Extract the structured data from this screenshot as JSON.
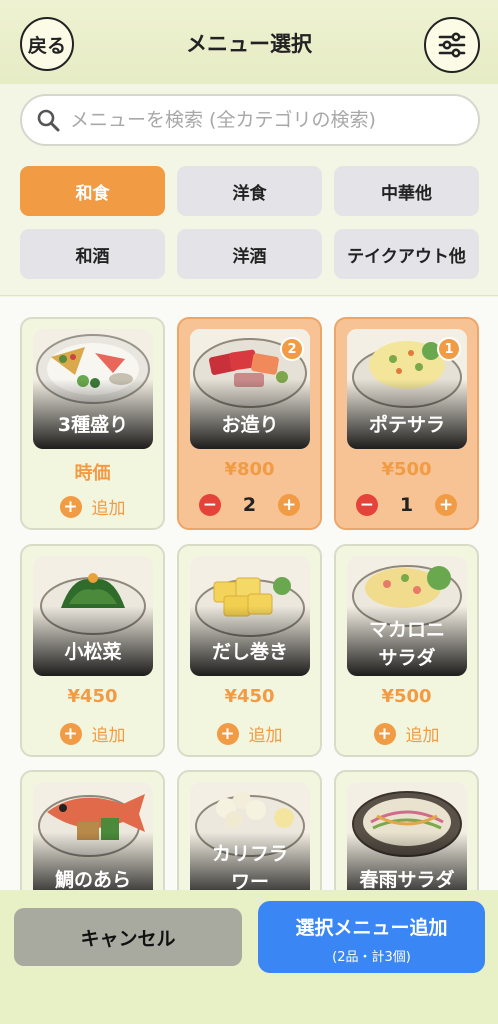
{
  "header": {
    "back_label": "戻る",
    "title": "メニュー選択",
    "settings_icon": "sliders-icon"
  },
  "search": {
    "placeholder": "メニューを検索 (全カテゴリの検索)",
    "value": ""
  },
  "categories": [
    {
      "label": "和食",
      "active": true
    },
    {
      "label": "洋食",
      "active": false
    },
    {
      "label": "中華他",
      "active": false
    },
    {
      "label": "和酒",
      "active": false
    },
    {
      "label": "洋酒",
      "active": false
    },
    {
      "label": "テイクアウト他",
      "active": false
    }
  ],
  "items": [
    {
      "name": "3種盛り",
      "price": "時価",
      "add_label": "追加",
      "selected": false
    },
    {
      "name": "お造り",
      "price": "¥800",
      "selected": true,
      "badge": "2",
      "qty": "2"
    },
    {
      "name": "ポテサラ",
      "price": "¥500",
      "selected": true,
      "badge": "1",
      "qty": "1"
    },
    {
      "name": "小松菜",
      "price": "¥450",
      "add_label": "追加",
      "selected": false
    },
    {
      "name": "だし巻き",
      "price": "¥450",
      "add_label": "追加",
      "selected": false
    },
    {
      "name": "マカロニ\nサラダ",
      "price": "¥500",
      "add_label": "追加",
      "selected": false
    },
    {
      "name": "鯛のあら",
      "selected": false
    },
    {
      "name": "カリフラ\nワー",
      "selected": false
    },
    {
      "name": "春雨サラダ",
      "selected": false
    }
  ],
  "footer": {
    "cancel_label": "キャンセル",
    "add_label": "選択メニュー追加",
    "add_sub": "(2品・計3個)"
  },
  "colors": {
    "accent": "#f29b45",
    "primary": "#3b86f5",
    "minus": "#e5433a"
  }
}
